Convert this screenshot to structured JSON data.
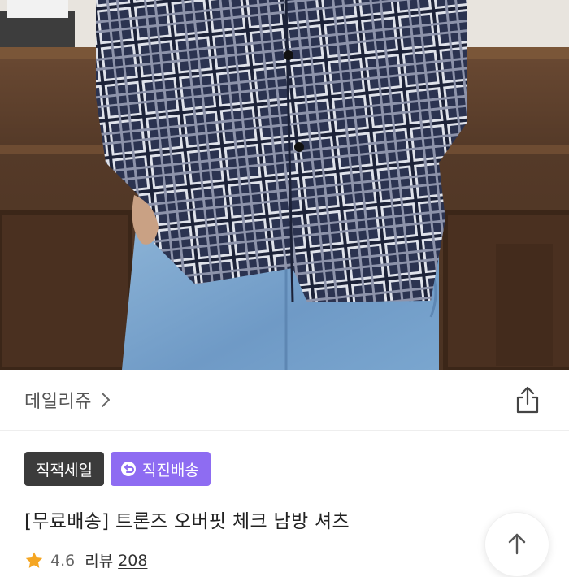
{
  "store": {
    "name": "데일리쥬"
  },
  "badges": [
    {
      "label": "직잭세일",
      "style": "dark"
    },
    {
      "label": "직진배송",
      "style": "purple",
      "icon": "return-arrow-icon"
    }
  ],
  "product": {
    "title": "[무료배송] 트론즈 오버핏 체크 남방 셔츠"
  },
  "rating": {
    "score": "4.6",
    "review_label": "리뷰",
    "review_count": "208"
  },
  "colors": {
    "purple": "#8e6cf2",
    "dark": "#3b3b3b",
    "star": "#f5a623"
  },
  "icons": {
    "share": "share-icon",
    "chevron": "chevron-right-icon",
    "top": "arrow-up-icon",
    "star": "star-icon"
  }
}
